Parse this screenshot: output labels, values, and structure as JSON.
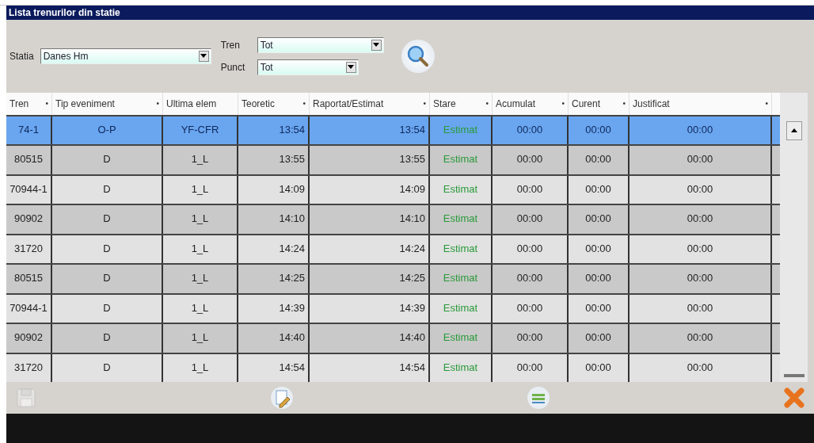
{
  "window": {
    "title": "Lista trenurilor din statie"
  },
  "filters": [
    {
      "label": "Statia",
      "value": "Danes Hm"
    },
    {
      "label": "Tren",
      "value": "Tot"
    },
    {
      "label": "Punct",
      "value": "Tot"
    }
  ],
  "table": {
    "columns": [
      {
        "label": "Tren",
        "mark": "•"
      },
      {
        "label": "Tip eveniment",
        "mark": "•"
      },
      {
        "label": "Ultima elem"
      },
      {
        "label": "Teoretic",
        "mark": "•"
      },
      {
        "label": "Raportat/Estimat",
        "mark": "•"
      },
      {
        "label": "Stare",
        "mark": "•"
      },
      {
        "label": "Acumulat",
        "mark": "•"
      },
      {
        "label": "Curent",
        "mark": "•"
      },
      {
        "label": "Justificat",
        "mark": "•"
      }
    ],
    "rows": [
      {
        "selected": true,
        "cells": [
          "74-1",
          "O-P",
          "YF-CFR",
          "13:54",
          "13:54",
          "Estimat",
          "00:00",
          "00:00",
          "00:00"
        ]
      },
      {
        "selected": false,
        "cells": [
          "80515",
          "D",
          "1_L",
          "13:55",
          "13:55",
          "Estimat",
          "00:00",
          "00:00",
          "00:00"
        ]
      },
      {
        "selected": false,
        "cells": [
          "70944-1",
          "D",
          "1_L",
          "14:09",
          "14:09",
          "Estimat",
          "00:00",
          "00:00",
          "00:00"
        ]
      },
      {
        "selected": false,
        "cells": [
          "90902",
          "D",
          "1_L",
          "14:10",
          "14:10",
          "Estimat",
          "00:00",
          "00:00",
          "00:00"
        ]
      },
      {
        "selected": false,
        "cells": [
          "31720",
          "D",
          "1_L",
          "14:24",
          "14:24",
          "Estimat",
          "00:00",
          "00:00",
          "00:00"
        ]
      },
      {
        "selected": false,
        "cells": [
          "80515",
          "D",
          "1_L",
          "14:25",
          "14:25",
          "Estimat",
          "00:00",
          "00:00",
          "00:00"
        ]
      },
      {
        "selected": false,
        "cells": [
          "70944-1",
          "D",
          "1_L",
          "14:39",
          "14:39",
          "Estimat",
          "00:00",
          "00:00",
          "00:00"
        ]
      },
      {
        "selected": false,
        "cells": [
          "90902",
          "D",
          "1_L",
          "14:40",
          "14:40",
          "Estimat",
          "00:00",
          "00:00",
          "00:00"
        ]
      },
      {
        "selected": false,
        "cells": [
          "31720",
          "D",
          "1_L",
          "14:54",
          "14:54",
          "Estimat",
          "00:00",
          "00:00",
          "00:00"
        ]
      }
    ]
  },
  "toolbar": [
    {
      "kind": "save",
      "disabled": true
    },
    {
      "kind": "edit",
      "disabled": false
    },
    {
      "kind": "list",
      "disabled": false
    },
    {
      "kind": "close",
      "disabled": false
    }
  ]
}
